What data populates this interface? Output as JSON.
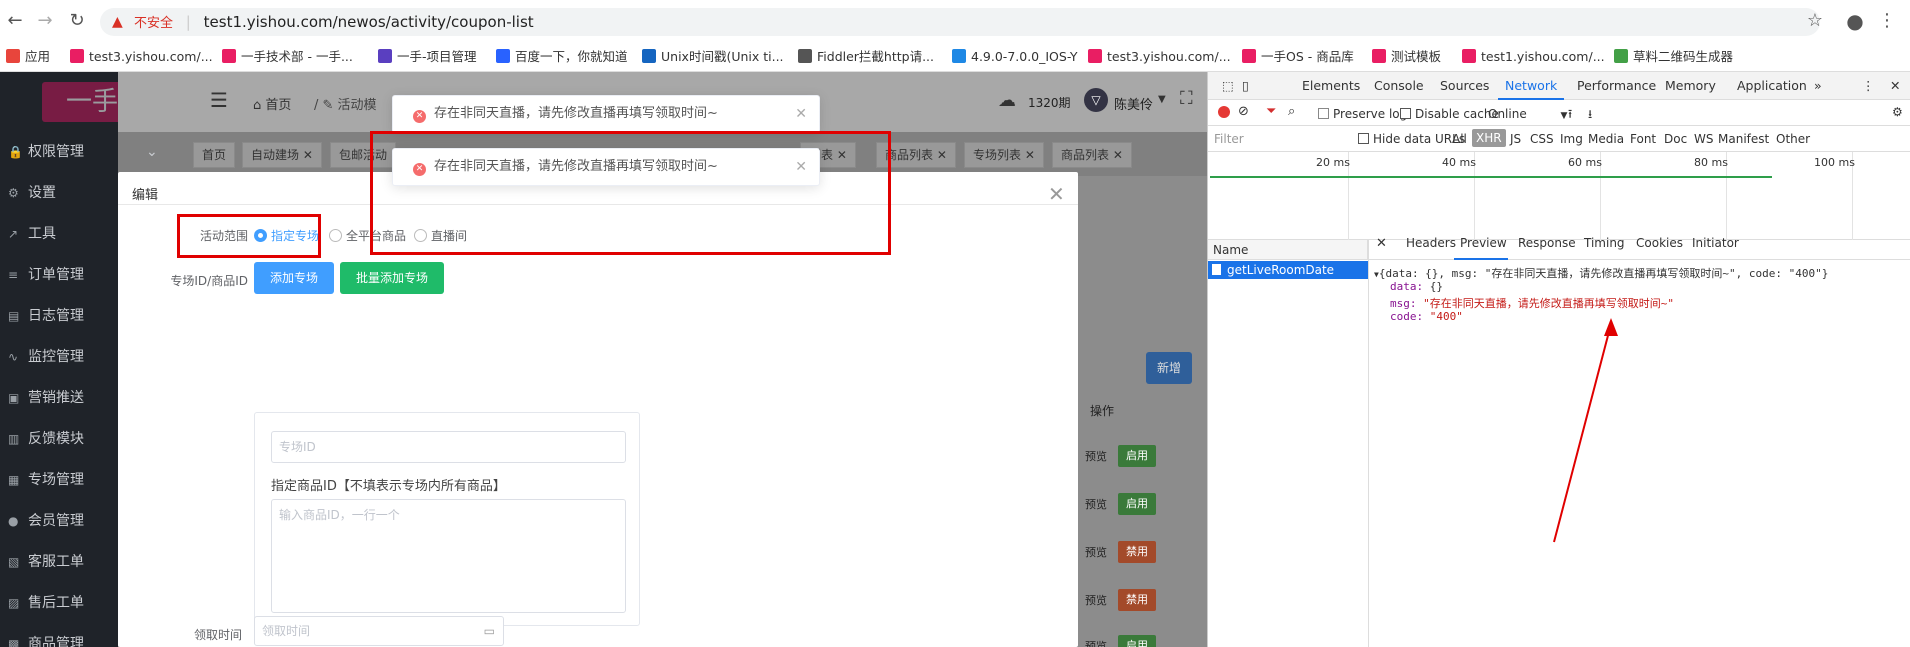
{
  "browser": {
    "security_label": "不安全",
    "url": "test1.yishou.com/newos/activity/coupon-list",
    "bookmarks": [
      "应用",
      "test3.yishou.com/...",
      "一手技术部 - 一手...",
      "一手-项目管理",
      "百度一下，你就知道",
      "Unix时间戳(Unix ti...",
      "Fiddler拦截http请...",
      "4.9.0-7.0.0_IOS-Y",
      "test3.yishou.com/...",
      "一手OS - 商品库",
      "测试模板",
      "test1.yishou.com/...",
      "草料二维码生成器"
    ]
  },
  "app": {
    "logo": "一手",
    "breadcrumb_home": "首页",
    "breadcrumb_activity": "活动模",
    "period": "1320期",
    "user": "陈美伶",
    "sidebar": [
      "权限管理",
      "设置",
      "工具",
      "订单管理",
      "日志管理",
      "监控管理",
      "营销推送",
      "反馈模块",
      "专场管理",
      "会员管理",
      "客服工单",
      "售后工单",
      "商品管理"
    ],
    "tags": [
      "首页",
      "自动建场",
      "包邮活动",
      "列表",
      "商品列表",
      "专场列表",
      "商品列表"
    ],
    "new_button": "新增",
    "op_header": "操作",
    "rows": [
      {
        "preview": "预览",
        "state": "启用"
      },
      {
        "preview": "预览",
        "state": "启用"
      },
      {
        "preview": "预览",
        "state": "禁用"
      },
      {
        "preview": "预览",
        "state": "禁用"
      },
      {
        "preview": "预览",
        "state": "启用"
      }
    ]
  },
  "dialog": {
    "title": "编辑",
    "scope_label": "活动范围",
    "scope_options": [
      "指定专场",
      "全平台商品",
      "直播间"
    ],
    "special_label": "专场ID/商品ID",
    "add_button": "添加专场",
    "batch_button": "批量添加专场",
    "special_placeholder": "专场ID",
    "goods_label": "指定商品ID【不填表示专场内所有商品】",
    "goods_placeholder": "输入商品ID，一行一个",
    "receive_label": "领取时间",
    "receive_placeholder": "领取时间"
  },
  "toasts": [
    "存在非同天直播，请先修改直播再填写领取时间~",
    "存在非同天直播，请先修改直播再填写领取时间~"
  ],
  "devtools": {
    "tabs": [
      "Elements",
      "Console",
      "Sources",
      "Network",
      "Performance",
      "Memory",
      "Application"
    ],
    "preserve_log": "Preserve log",
    "disable_cache": "Disable cache",
    "throttle": "Online",
    "filter_placeholder": "Filter",
    "hide_data_urls": "Hide data URLs",
    "types": [
      "All",
      "XHR",
      "JS",
      "CSS",
      "Img",
      "Media",
      "Font",
      "Doc",
      "WS",
      "Manifest",
      "Other"
    ],
    "ticks": [
      "20 ms",
      "40 ms",
      "60 ms",
      "80 ms",
      "100 ms"
    ],
    "name_header": "Name",
    "request": "getLiveRoomDate",
    "panel_tabs": [
      "Headers",
      "Preview",
      "Response",
      "Timing",
      "Cookies",
      "Initiator"
    ],
    "json_summary": "{data: {}, msg: \"存在非同天直播，请先修改直播再填写领取时间~\", code: \"400\"}",
    "json_data_key": "data:",
    "json_data_val": "{}",
    "json_msg_key": "msg:",
    "json_msg_val": "\"存在非同天直播，请先修改直播再填写领取时间~\"",
    "json_code_key": "code:",
    "json_code_val": "\"400\""
  }
}
